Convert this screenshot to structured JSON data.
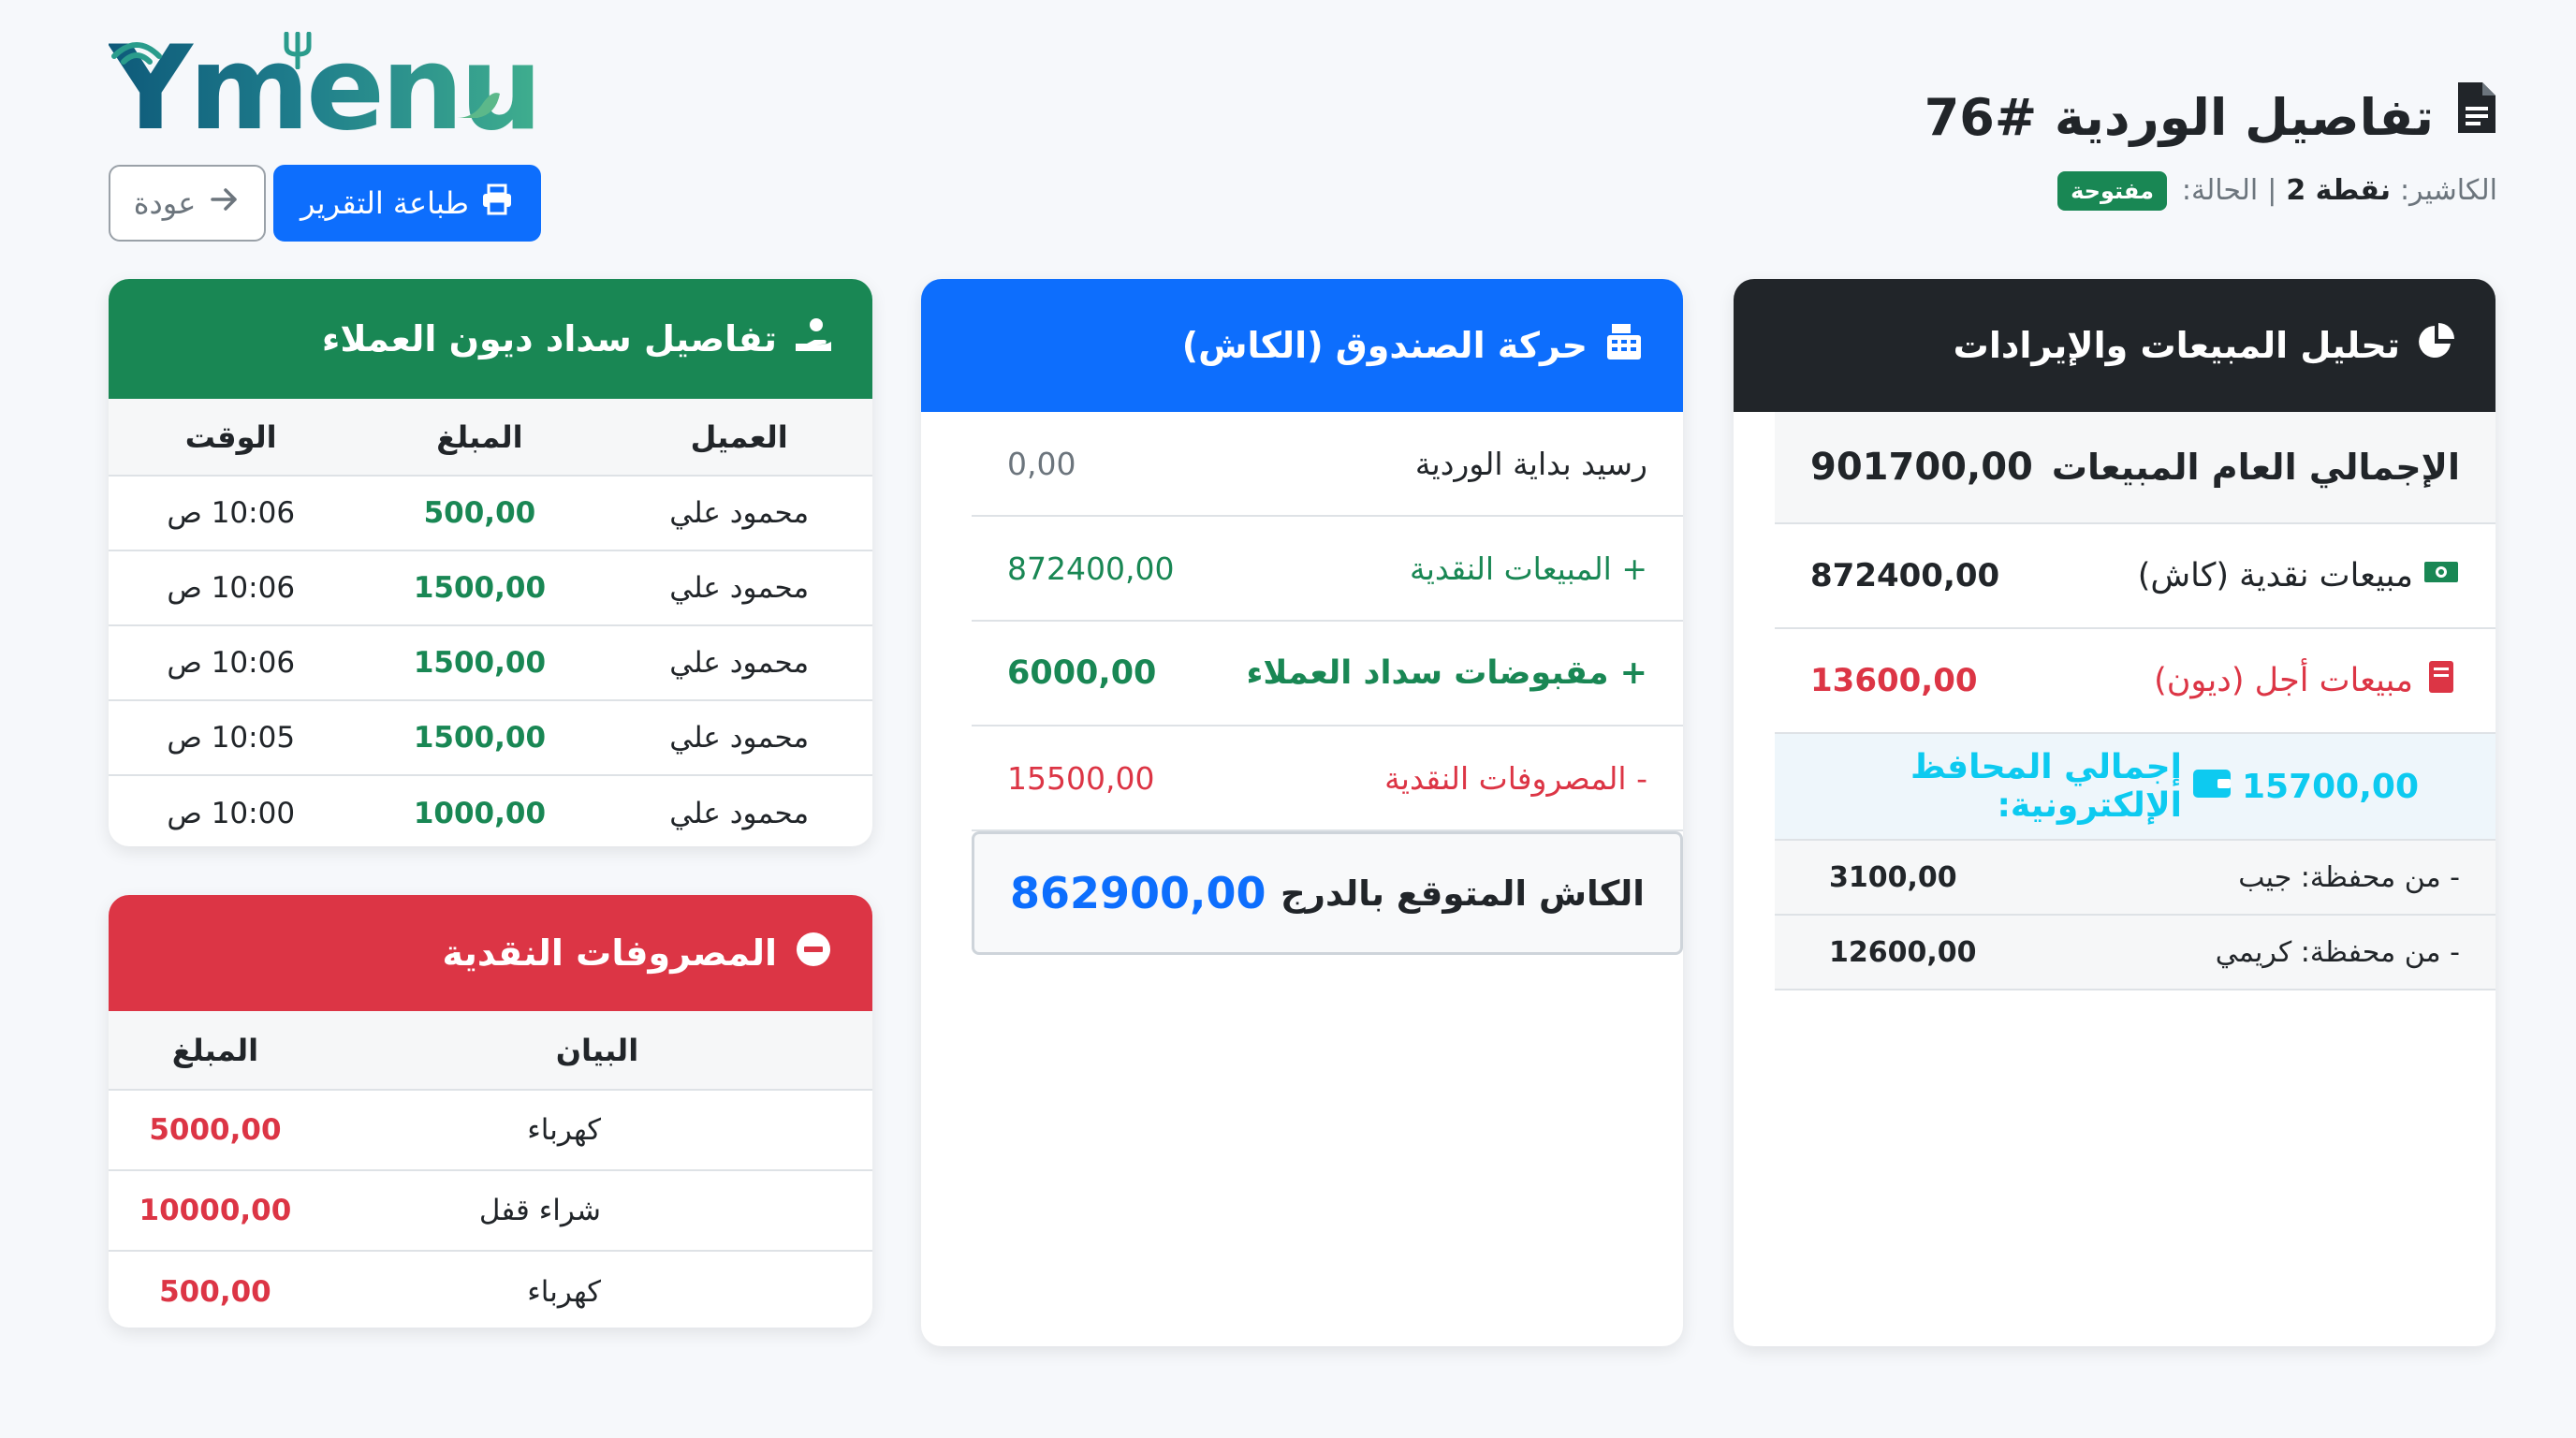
{
  "header": {
    "title": "تفاصيل الوردية #76",
    "cashier_label": "الكاشير:",
    "cashier_name": "نقطة 2",
    "separator": "|",
    "status_label": "الحالة:",
    "status_value": "مفتوحة"
  },
  "logo": {
    "text": "Ymenu"
  },
  "toolbar": {
    "back_label": "عودة",
    "print_label": "طباعة التقرير"
  },
  "sales": {
    "title": "تحليل المبيعات والإيرادات",
    "total_label": "الإجمالي العام المبيعات",
    "total_value": "901700,00",
    "cash_label": "مبيعات نقدية (كاش)",
    "cash_value": "872400,00",
    "credit_label": "مبيعات أجل (ديون)",
    "credit_value": "13600,00",
    "wallets_label": "إجمالي المحافظ الإلكترونية:",
    "wallets_value": "15700,00",
    "wallets": [
      {
        "label": "- من محفظة: جيب",
        "value": "3100,00"
      },
      {
        "label": "- من محفظة: كريمي",
        "value": "12600,00"
      }
    ]
  },
  "cash": {
    "title": "حركة الصندوق (الكاش)",
    "rows": [
      {
        "label": "رسيد بداية الوردية",
        "value": "0,00"
      },
      {
        "label": "+ المبيعات النقدية",
        "value": "872400,00"
      },
      {
        "label": "+ مقبوضات سداد العملاء",
        "value": "6000,00"
      },
      {
        "label": "- المصروفات النقدية",
        "value": "15500,00"
      }
    ],
    "expected_label": "الكاش المتوقع بالدرج",
    "expected_value": "862900,00"
  },
  "debts": {
    "title": "تفاصيل سداد ديون العملاء",
    "columns": [
      "العميل",
      "المبلغ",
      "الوقت"
    ],
    "rows": [
      {
        "client": "محمود علي",
        "amount": "500,00",
        "time": "10:06 ص"
      },
      {
        "client": "محمود علي",
        "amount": "1500,00",
        "time": "10:06 ص"
      },
      {
        "client": "محمود علي",
        "amount": "1500,00",
        "time": "10:06 ص"
      },
      {
        "client": "محمود علي",
        "amount": "1500,00",
        "time": "10:05 ص"
      },
      {
        "client": "محمود علي",
        "amount": "1000,00",
        "time": "10:00 ص"
      }
    ]
  },
  "expenses": {
    "title": "المصروفات النقدية",
    "columns": [
      "البيان",
      "المبلغ"
    ],
    "rows": [
      {
        "desc": "كهرباء",
        "amount": "5000,00"
      },
      {
        "desc": "شراء قفل",
        "amount": "10000,00"
      },
      {
        "desc": "كهرباء",
        "amount": "500,00"
      }
    ]
  },
  "colors": {
    "primary": "#0d6efd",
    "success": "#198754",
    "danger": "#dc3545",
    "dark": "#212529",
    "info": "#0dcaf0"
  },
  "icons": {
    "title": "document-icon",
    "print": "printer-icon",
    "back": "arrow-right-icon",
    "sales": "pie-chart-icon",
    "cash": "cash-register-icon",
    "debts": "hand-coin-icon",
    "expenses": "minus-circle-icon",
    "cash_sales": "banknote-icon",
    "credit_sales": "ledger-icon",
    "wallets": "wallet-icon"
  }
}
